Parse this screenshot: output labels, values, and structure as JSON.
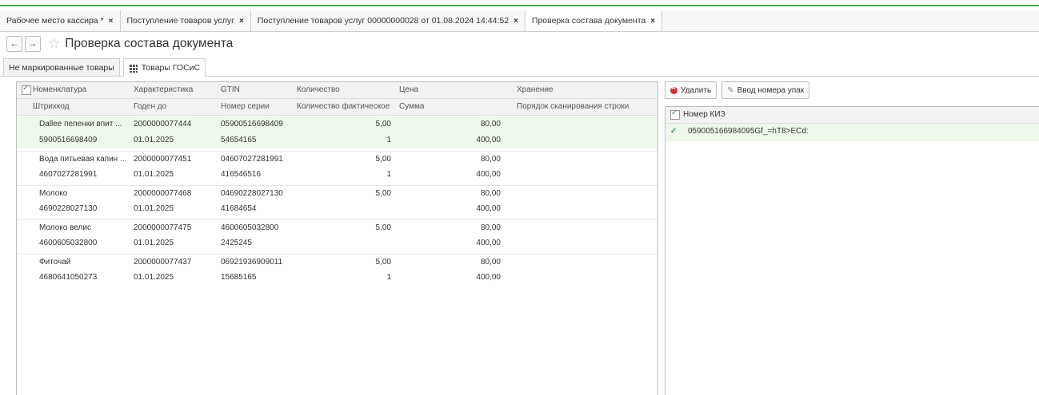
{
  "tabs": [
    {
      "label": "Рабочее место кассира *",
      "close": "×"
    },
    {
      "label": "Поступление товаров услуг",
      "close": "×"
    },
    {
      "label": "Поступление товаров услуг 00000000028 от 01.08.2024 14:44:52",
      "close": "×"
    },
    {
      "label": "Проверка состава документа",
      "close": "×"
    }
  ],
  "title": "Проверка состава документа",
  "nav": {
    "back": "←",
    "forward": "→",
    "star": "☆"
  },
  "subtabs": [
    "Не маркированные товары",
    "Товары ГОСиС"
  ],
  "table": {
    "headers_top": [
      "Номенклатура",
      "Характеристика",
      "GTIN",
      "Количество",
      "Цена",
      "Хранение"
    ],
    "headers_bottom": [
      "Штрихкод",
      "Годен до",
      "Номер серии",
      "Количество фактическое",
      "Сумма",
      "Порядок сканирования строки"
    ],
    "rows": [
      {
        "name": "Dallee пеленки впит ...",
        "char": "2000000077444",
        "gtin": "05900516698409",
        "qty": "5,00",
        "price": "80,00",
        "barcode": "5900516698409",
        "exp": "01.01.2025",
        "serial": "54654165",
        "fact": "1",
        "sum": "400,00"
      },
      {
        "name": "Вода питьевая капин ...",
        "char": "2000000077451",
        "gtin": "04607027281991",
        "qty": "5,00",
        "price": "80,00",
        "barcode": "4607027281991",
        "exp": "01.01.2025",
        "serial": "416546516",
        "fact": "1",
        "sum": "400,00"
      },
      {
        "name": "Молоко",
        "char": "2000000077468",
        "gtin": "04690228027130",
        "qty": "5,00",
        "price": "80,00",
        "barcode": "4690228027130",
        "exp": "01.01.2025",
        "serial": "41684654",
        "fact": "",
        "sum": "400,00"
      },
      {
        "name": "Молоко велис",
        "char": "2000000077475",
        "gtin": "4600605032800",
        "qty": "5,00",
        "price": "80,00",
        "barcode": "4600605032800",
        "exp": "01.01.2025",
        "serial": "2425245",
        "fact": "",
        "sum": "400,00"
      },
      {
        "name": "Фиточай",
        "char": "2000000077437",
        "gtin": "06921936909011",
        "qty": "5,00",
        "price": "80,00",
        "barcode": "4680641050273",
        "exp": "01.01.2025",
        "serial": "15685165",
        "fact": "1",
        "sum": "400,00"
      }
    ]
  },
  "right": {
    "delete_label": "Удалить",
    "input_label": "Ввод номера упак",
    "header": "Номер КИЗ",
    "kiz": "059005166984095Gf_=hT8>ECd:"
  },
  "colors": {
    "accent": "#4aa84a",
    "selected_row": "#eef8ea",
    "delete": "#d32f2f"
  }
}
